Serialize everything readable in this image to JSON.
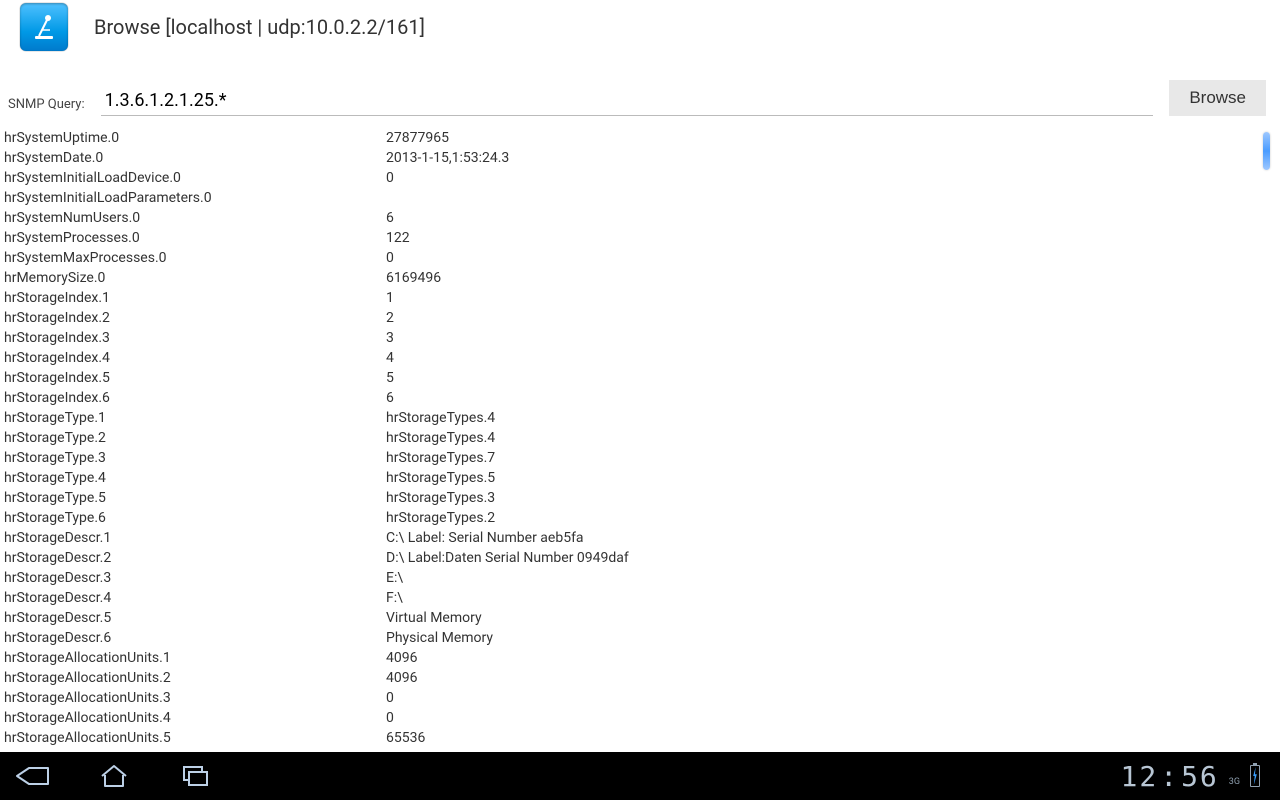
{
  "header": {
    "title": "Browse [localhost | udp:10.0.2.2/161]"
  },
  "query": {
    "label": "SNMP Query:",
    "value": "1.3.6.1.2.1.25.*",
    "browse_label": "Browse"
  },
  "results": [
    {
      "oid": "hrSystemUptime.0",
      "value": "27877965"
    },
    {
      "oid": "hrSystemDate.0",
      "value": "2013-1-15,1:53:24.3"
    },
    {
      "oid": "hrSystemInitialLoadDevice.0",
      "value": "0"
    },
    {
      "oid": "hrSystemInitialLoadParameters.0",
      "value": ""
    },
    {
      "oid": "hrSystemNumUsers.0",
      "value": "6"
    },
    {
      "oid": "hrSystemProcesses.0",
      "value": "122"
    },
    {
      "oid": "hrSystemMaxProcesses.0",
      "value": "0"
    },
    {
      "oid": "hrMemorySize.0",
      "value": "6169496"
    },
    {
      "oid": "hrStorageIndex.1",
      "value": "1"
    },
    {
      "oid": "hrStorageIndex.2",
      "value": "2"
    },
    {
      "oid": "hrStorageIndex.3",
      "value": "3"
    },
    {
      "oid": "hrStorageIndex.4",
      "value": "4"
    },
    {
      "oid": "hrStorageIndex.5",
      "value": "5"
    },
    {
      "oid": "hrStorageIndex.6",
      "value": "6"
    },
    {
      "oid": "hrStorageType.1",
      "value": "hrStorageTypes.4"
    },
    {
      "oid": "hrStorageType.2",
      "value": "hrStorageTypes.4"
    },
    {
      "oid": "hrStorageType.3",
      "value": "hrStorageTypes.7"
    },
    {
      "oid": "hrStorageType.4",
      "value": "hrStorageTypes.5"
    },
    {
      "oid": "hrStorageType.5",
      "value": "hrStorageTypes.3"
    },
    {
      "oid": "hrStorageType.6",
      "value": "hrStorageTypes.2"
    },
    {
      "oid": "hrStorageDescr.1",
      "value": "C:\\ Label:  Serial Number   aeb5fa"
    },
    {
      "oid": "hrStorageDescr.2",
      "value": "D:\\ Label:Daten  Serial Number   0949daf"
    },
    {
      "oid": "hrStorageDescr.3",
      "value": "E:\\"
    },
    {
      "oid": "hrStorageDescr.4",
      "value": "F:\\"
    },
    {
      "oid": "hrStorageDescr.5",
      "value": "Virtual Memory"
    },
    {
      "oid": "hrStorageDescr.6",
      "value": "Physical Memory"
    },
    {
      "oid": "hrStorageAllocationUnits.1",
      "value": "4096"
    },
    {
      "oid": "hrStorageAllocationUnits.2",
      "value": "4096"
    },
    {
      "oid": "hrStorageAllocationUnits.3",
      "value": "0"
    },
    {
      "oid": "hrStorageAllocationUnits.4",
      "value": "0"
    },
    {
      "oid": "hrStorageAllocationUnits.5",
      "value": "65536"
    }
  ],
  "navbar": {
    "clock_hours": "12",
    "clock_minutes": "56",
    "signal_label": "3G"
  }
}
